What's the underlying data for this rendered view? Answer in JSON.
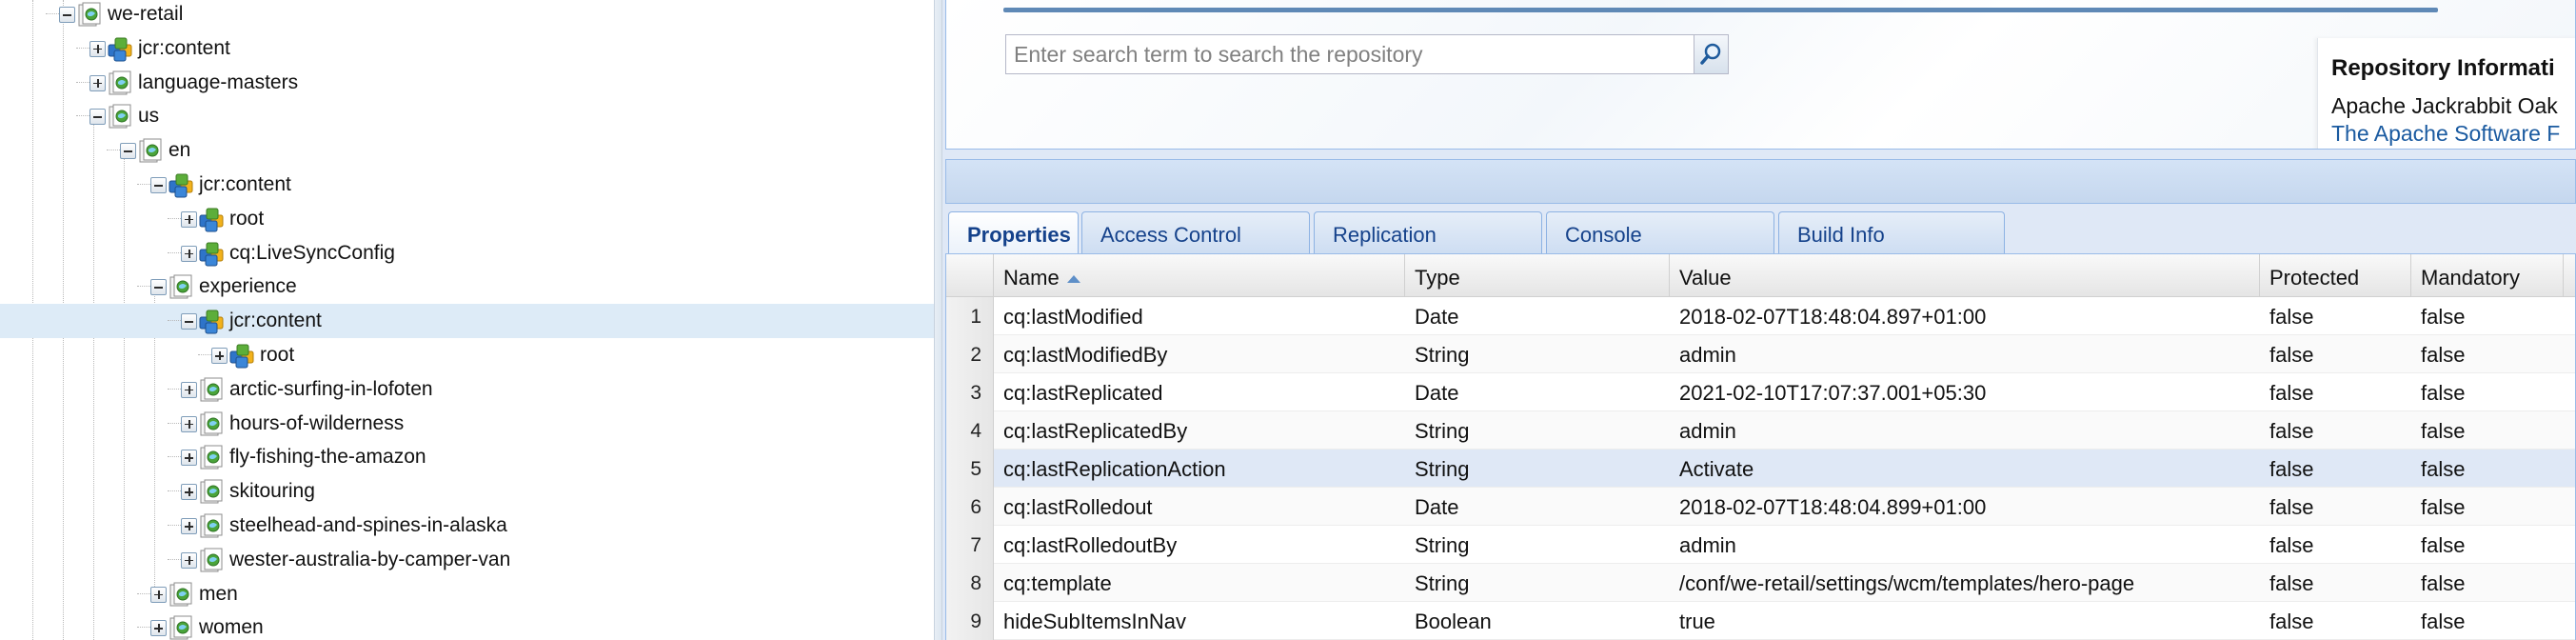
{
  "tree": {
    "nodes": [
      {
        "label": "we-retail",
        "toggle": "minus",
        "icon": "page-icon"
      },
      {
        "label": "jcr:content",
        "toggle": "plus",
        "icon": "content-node-icon"
      },
      {
        "label": "language-masters",
        "toggle": "plus",
        "icon": "page-icon"
      },
      {
        "label": "us",
        "toggle": "minus",
        "icon": "page-icon"
      },
      {
        "label": "en",
        "toggle": "minus",
        "icon": "page-icon"
      },
      {
        "label": "jcr:content",
        "toggle": "minus",
        "icon": "content-node-icon"
      },
      {
        "label": "root",
        "toggle": "plus",
        "icon": "content-node-icon"
      },
      {
        "label": "cq:LiveSyncConfig",
        "toggle": "plus",
        "icon": "content-node-icon"
      },
      {
        "label": "experience",
        "toggle": "minus",
        "icon": "page-icon"
      },
      {
        "label": "jcr:content",
        "toggle": "minus",
        "icon": "content-node-icon",
        "selected": true
      },
      {
        "label": "root",
        "toggle": "plus",
        "icon": "content-node-icon"
      },
      {
        "label": "arctic-surfing-in-lofoten",
        "toggle": "plus",
        "icon": "page-icon"
      },
      {
        "label": "hours-of-wilderness",
        "toggle": "plus",
        "icon": "page-icon"
      },
      {
        "label": "fly-fishing-the-amazon",
        "toggle": "plus",
        "icon": "page-icon"
      },
      {
        "label": "skitouring",
        "toggle": "plus",
        "icon": "page-icon"
      },
      {
        "label": "steelhead-and-spines-in-alaska",
        "toggle": "plus",
        "icon": "page-icon"
      },
      {
        "label": "wester-australia-by-camper-van",
        "toggle": "plus",
        "icon": "page-icon"
      },
      {
        "label": "men",
        "toggle": "plus",
        "icon": "page-icon"
      },
      {
        "label": "women",
        "toggle": "plus",
        "icon": "page-icon"
      }
    ]
  },
  "search": {
    "placeholder": "Enter search term to search the repository",
    "icon": "search-icon"
  },
  "repository_info": {
    "title": "Repository Informati",
    "product": "Apache Jackrabbit Oak",
    "vendor": "The Apache Software F"
  },
  "tabs": [
    {
      "label": "Properties",
      "active": true
    },
    {
      "label": "Access Control"
    },
    {
      "label": "Replication"
    },
    {
      "label": "Console"
    },
    {
      "label": "Build Info"
    }
  ],
  "grid": {
    "columns": [
      "Name",
      "Type",
      "Value",
      "Protected",
      "Mandatory"
    ],
    "sort_column": "Name",
    "sort_direction": "ascending",
    "rows": [
      {
        "num": "1",
        "name": "cq:lastModified",
        "type": "Date",
        "value": "2018-02-07T18:48:04.897+01:00",
        "protected": "false",
        "mandatory": "false"
      },
      {
        "num": "2",
        "name": "cq:lastModifiedBy",
        "type": "String",
        "value": "admin",
        "protected": "false",
        "mandatory": "false"
      },
      {
        "num": "3",
        "name": "cq:lastReplicated",
        "type": "Date",
        "value": "2021-02-10T17:07:37.001+05:30",
        "protected": "false",
        "mandatory": "false"
      },
      {
        "num": "4",
        "name": "cq:lastReplicatedBy",
        "type": "String",
        "value": "admin",
        "protected": "false",
        "mandatory": "false"
      },
      {
        "num": "5",
        "name": "cq:lastReplicationAction",
        "type": "String",
        "value": "Activate",
        "protected": "false",
        "mandatory": "false",
        "selected": true
      },
      {
        "num": "6",
        "name": "cq:lastRolledout",
        "type": "Date",
        "value": "2018-02-07T18:48:04.899+01:00",
        "protected": "false",
        "mandatory": "false"
      },
      {
        "num": "7",
        "name": "cq:lastRolledoutBy",
        "type": "String",
        "value": "admin",
        "protected": "false",
        "mandatory": "false"
      },
      {
        "num": "8",
        "name": "cq:template",
        "type": "String",
        "value": "/conf/we-retail/settings/wcm/templates/hero-page",
        "protected": "false",
        "mandatory": "false"
      },
      {
        "num": "9",
        "name": "hideSubItemsInNav",
        "type": "Boolean",
        "value": "true",
        "protected": "false",
        "mandatory": "false"
      }
    ]
  },
  "colors": {
    "selection": "#ddebf7",
    "tab_text": "#15428b",
    "panel_border": "#99bbe8",
    "link": "#1a5aa0"
  }
}
